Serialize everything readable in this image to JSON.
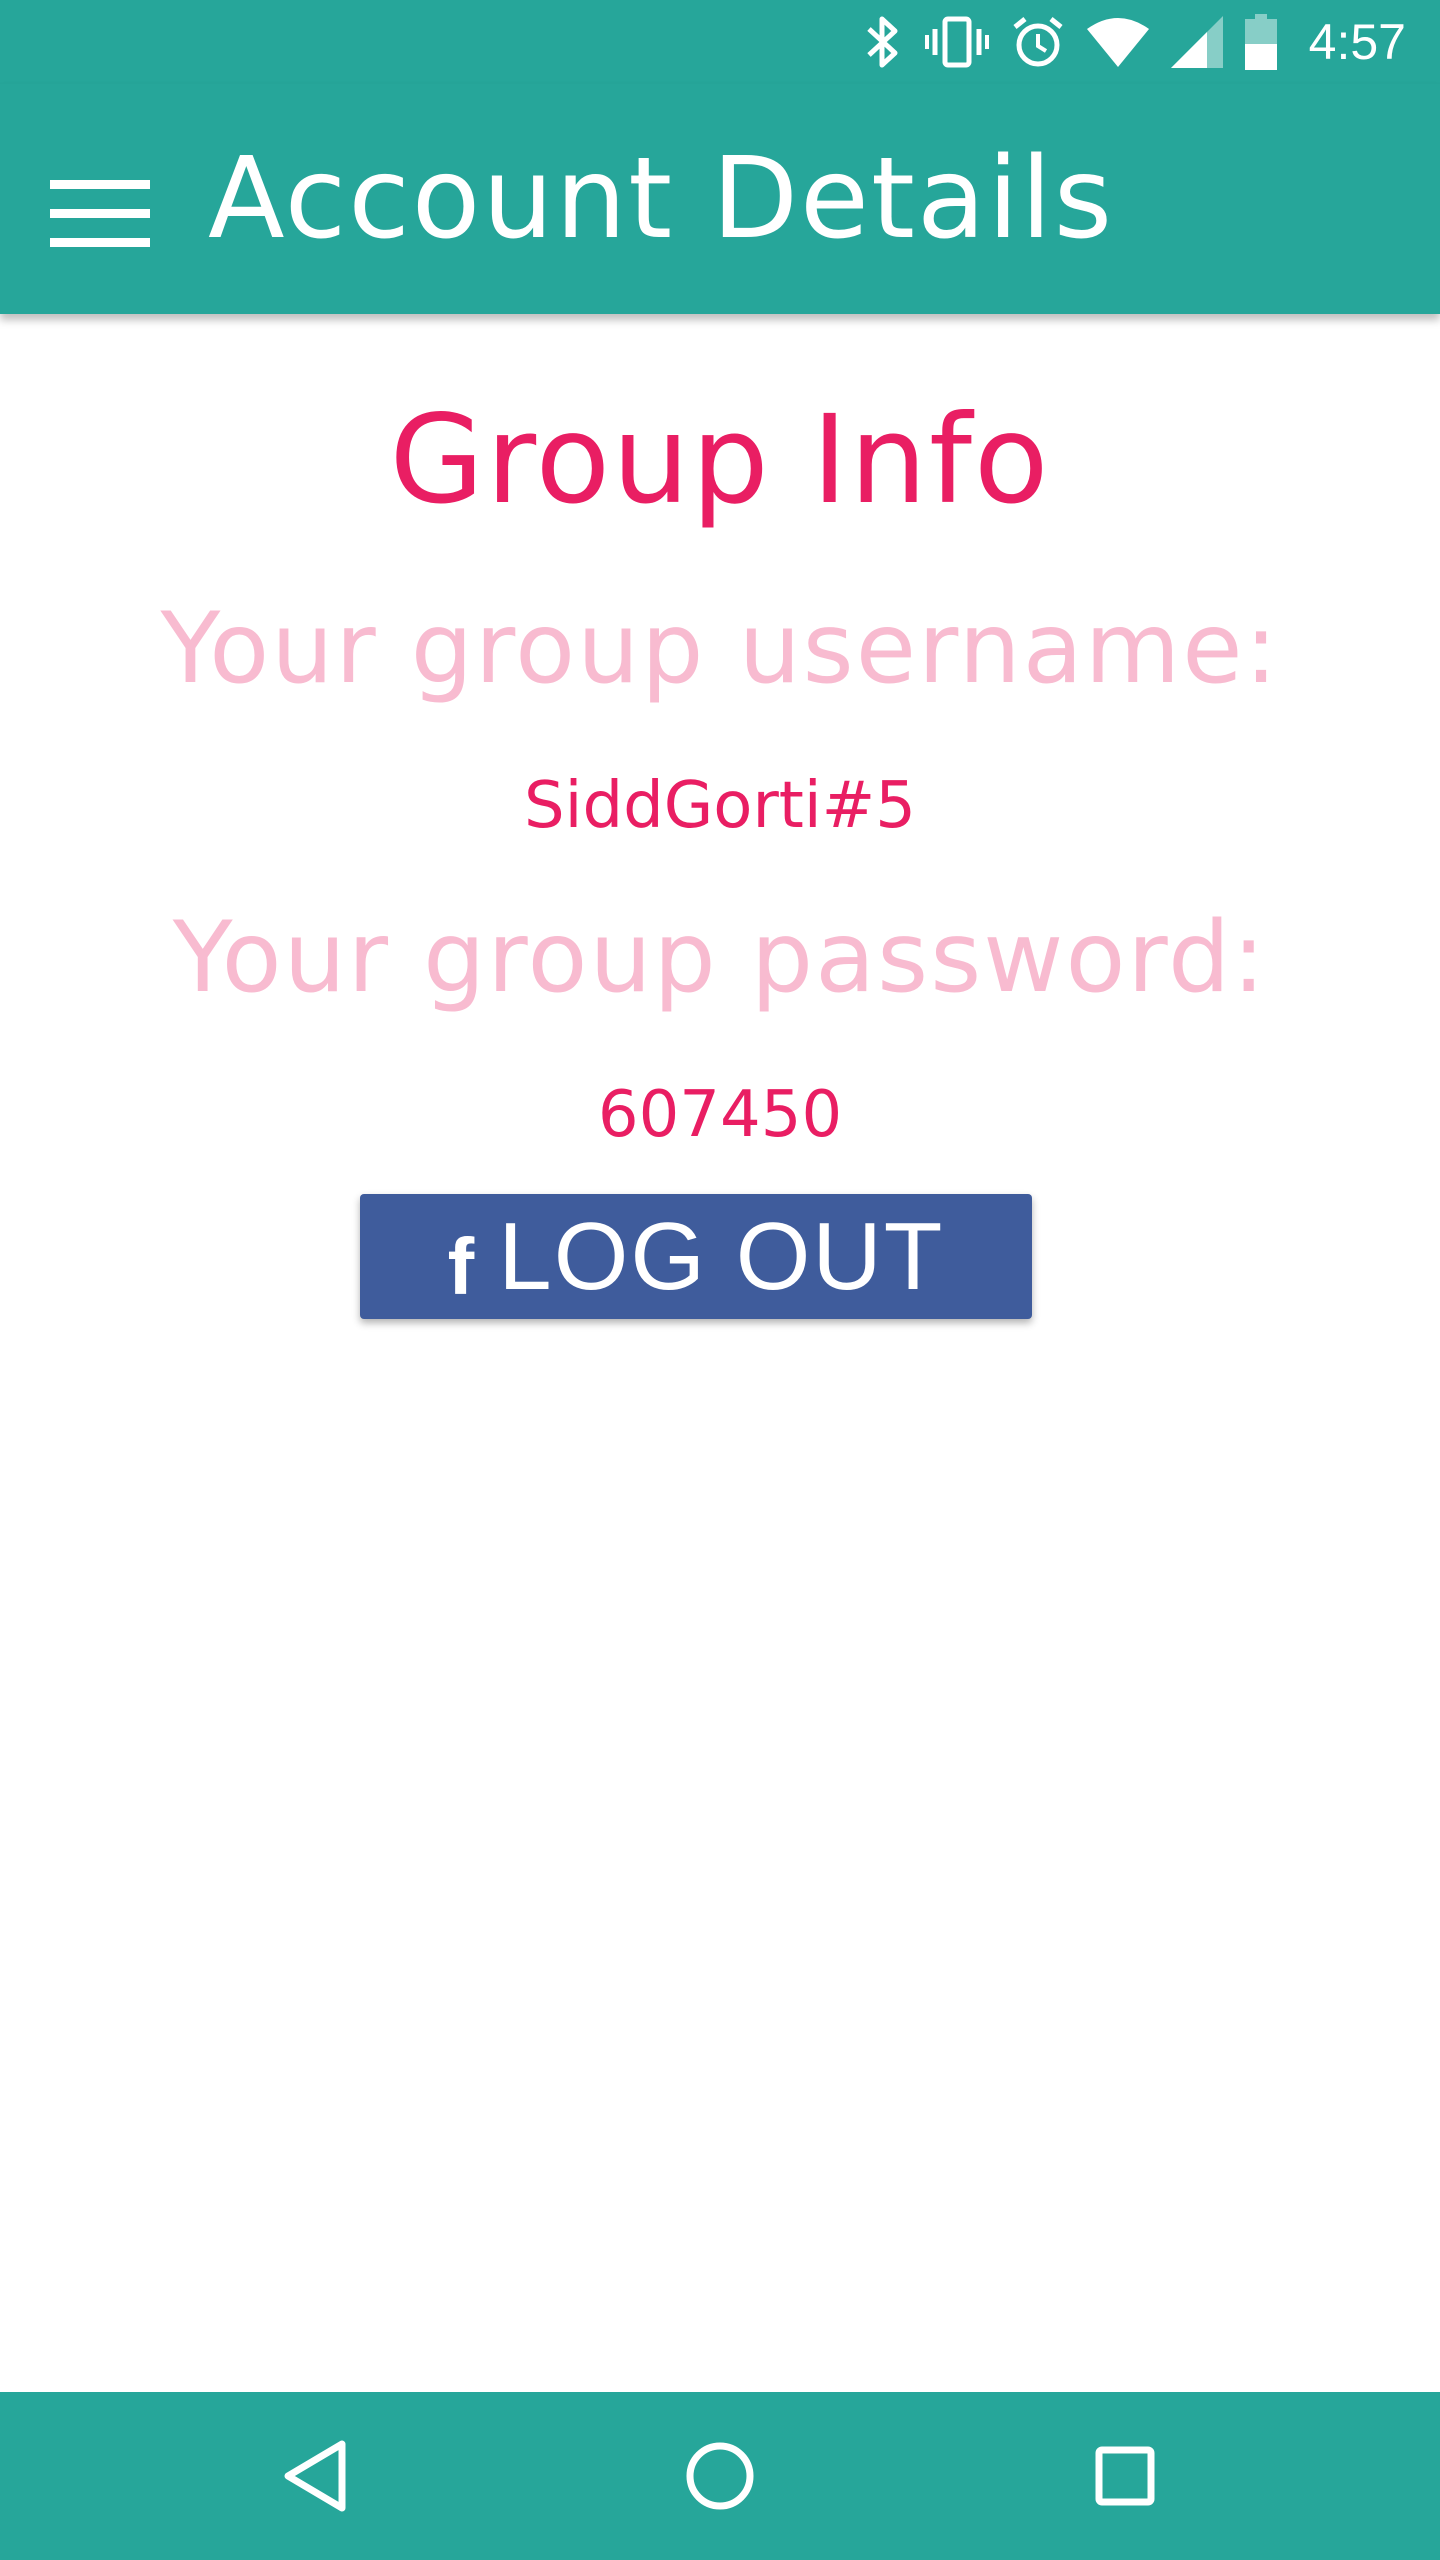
{
  "status_bar": {
    "time": "4:57",
    "icons": [
      "bluetooth-icon",
      "vibrate-icon",
      "alarm-icon",
      "wifi-icon",
      "cell-signal-icon",
      "battery-icon"
    ]
  },
  "app_bar": {
    "title": "Account Details",
    "menu_icon": "hamburger-menu-icon"
  },
  "group_info": {
    "title": "Group Info",
    "username_label": "Your group username:",
    "username_value": "SiddGorti#5",
    "password_label": "Your group password:",
    "password_value": "607450"
  },
  "logout_button": {
    "icon_glyph": "f",
    "label": "LOG OUT"
  },
  "nav_bar": {
    "buttons": [
      "back-icon",
      "home-icon",
      "recents-icon"
    ]
  },
  "colors": {
    "primary": "#26a69a",
    "accent": "#e91e63",
    "accent_light": "#f8bbd0",
    "facebook_blue": "#3f5c9c"
  }
}
